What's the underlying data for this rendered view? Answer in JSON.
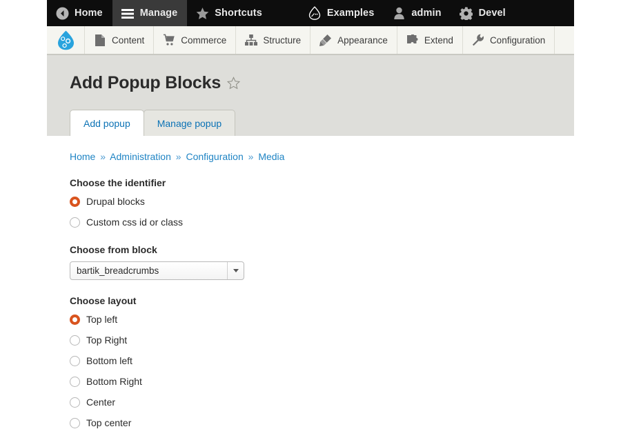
{
  "toolbar": {
    "items": [
      {
        "label": "Home",
        "icon": "back-circle-icon",
        "active": false
      },
      {
        "label": "Manage",
        "icon": "hamburger-icon",
        "active": true
      },
      {
        "label": "Shortcuts",
        "icon": "star-icon",
        "active": false
      },
      {
        "label": "Examples",
        "icon": "drupal-drop-icon",
        "active": false
      },
      {
        "label": "admin",
        "icon": "user-icon",
        "active": false
      },
      {
        "label": "Devel",
        "icon": "gear-icon",
        "active": false
      }
    ]
  },
  "admin_menu": {
    "logo": "drupal-logo-icon",
    "items": [
      {
        "label": "Content",
        "icon": "document-icon"
      },
      {
        "label": "Commerce",
        "icon": "shopping-cart-icon"
      },
      {
        "label": "Structure",
        "icon": "sitemap-icon"
      },
      {
        "label": "Appearance",
        "icon": "paintbrush-icon"
      },
      {
        "label": "Extend",
        "icon": "puzzle-piece-icon"
      },
      {
        "label": "Configuration",
        "icon": "wrench-icon"
      }
    ]
  },
  "page": {
    "title": "Add Popup Blocks",
    "favorite_icon": "star-outline-icon",
    "tabs": [
      {
        "label": "Add popup",
        "active": true
      },
      {
        "label": "Manage popup",
        "active": false
      }
    ],
    "breadcrumb": [
      "Home",
      "Administration",
      "Configuration",
      "Media"
    ],
    "breadcrumb_separator": "»"
  },
  "form": {
    "identifier": {
      "label": "Choose the identifier",
      "options": [
        {
          "label": "Drupal blocks",
          "selected": true
        },
        {
          "label": "Custom css id or class",
          "selected": false
        }
      ]
    },
    "block": {
      "label": "Choose from block",
      "value": "bartik_breadcrumbs",
      "arrow_icon": "chevron-down-icon"
    },
    "layout": {
      "label": "Choose layout",
      "options": [
        {
          "label": "Top left",
          "selected": true
        },
        {
          "label": "Top Right",
          "selected": false
        },
        {
          "label": "Bottom left",
          "selected": false
        },
        {
          "label": "Bottom Right",
          "selected": false
        },
        {
          "label": "Center",
          "selected": false
        },
        {
          "label": "Top center",
          "selected": false
        }
      ]
    }
  },
  "colors": {
    "toolbar_bg": "#0d0d0d",
    "toolbar_active_bg": "#3a3a3a",
    "menu_bg": "#f5f5f0",
    "page_head_bg": "#dededa",
    "link": "#1f84c4",
    "radio_selected": "#d9541e",
    "drupal_blue": "#29a3dd"
  }
}
